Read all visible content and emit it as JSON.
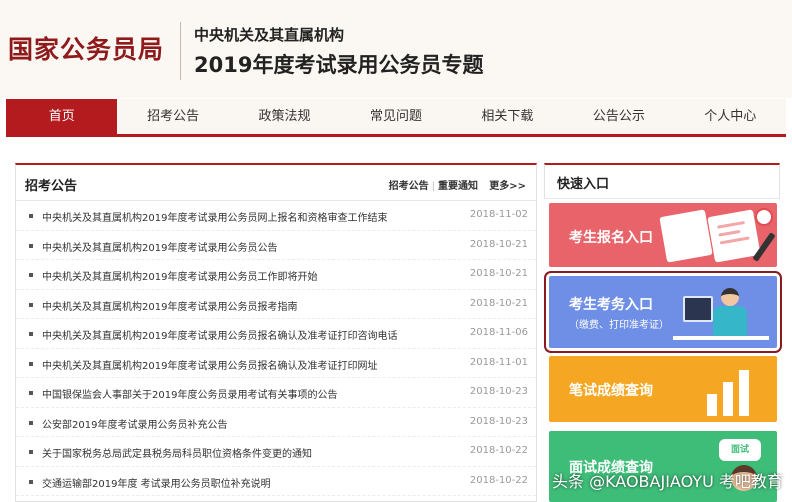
{
  "header": {
    "logo": "国家公务员局",
    "subtitle": "中央机关及其直属机构",
    "topic": "2019年度考试录用公务员专题"
  },
  "nav": {
    "items": [
      {
        "label": "首页",
        "active": true
      },
      {
        "label": "招考公告",
        "active": false
      },
      {
        "label": "政策法规",
        "active": false
      },
      {
        "label": "常见问题",
        "active": false
      },
      {
        "label": "相关下载",
        "active": false
      },
      {
        "label": "公告公示",
        "active": false
      },
      {
        "label": "个人中心",
        "active": false
      }
    ]
  },
  "announcements": {
    "title": "招考公告",
    "link_announcements": "招考公告",
    "link_notices": "重要通知",
    "more": "更多>>",
    "items": [
      {
        "title": "中央机关及其直属机构2019年度考试录用公务员网上报名和资格审查工作结束",
        "date": "2018-11-02"
      },
      {
        "title": "中央机关及其直属机构2019年度考试录用公务员公告",
        "date": "2018-10-21"
      },
      {
        "title": "中央机关及其直属机构2019年度考试录用公务员工作即将开始",
        "date": "2018-10-21"
      },
      {
        "title": "中央机关及其直属机构2019年度考试录用公务员报考指南",
        "date": "2018-10-21"
      },
      {
        "title": "中央机关及其直属机构2019年度考试录用公务员报名确认及准考证打印咨询电话",
        "date": "2018-11-06"
      },
      {
        "title": "中央机关及其直属机构2019年度考试录用公务员报名确认及准考证打印网址",
        "date": "2018-11-01"
      },
      {
        "title": "中国银保监会人事部关于2019年度公务员录用考试有关事项的公告",
        "date": "2018-10-23"
      },
      {
        "title": "公安部2019年度考试录用公务员补充公告",
        "date": "2018-10-23"
      },
      {
        "title": "关于国家税务总局武定县税务局科员职位资格条件变更的通知",
        "date": "2018-10-22"
      },
      {
        "title": "交通运输部2019年度 考试录用公务员职位补充说明",
        "date": "2018-10-22"
      }
    ]
  },
  "quick_access": {
    "title": "快速入口",
    "registration": "考生报名入口",
    "exam_affairs": "考生考务入口",
    "exam_affairs_sub": "（缴费、打印准考证）",
    "written_scores": "笔试成绩查询",
    "interview_scores": "面试成绩查询",
    "interview_bubble": "面试"
  },
  "watermark": "头条 @KAOBAJIAOYU 考吧教育",
  "colors": {
    "brand_red": "#b31b1e",
    "card_registration": "#e8646a",
    "card_exam_affairs": "#6f8fe6",
    "card_written": "#f5a623",
    "card_interview": "#3ebd78"
  }
}
